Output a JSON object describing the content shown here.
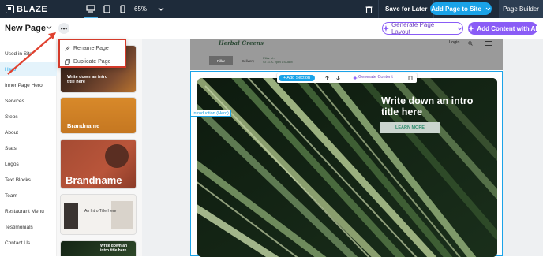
{
  "topbar": {
    "logo": "BLAZE",
    "zoom": "65%",
    "save_later": "Save for Later",
    "add_page": "Add Page to Site",
    "page_builder": "Page Builder"
  },
  "subbar": {
    "page_title": "New Page",
    "generate_layout": "Generate Page Layout",
    "add_content_ai": "Add Content with AI"
  },
  "popup": {
    "rename": "Rename Page",
    "duplicate": "Duplicate Page"
  },
  "sidebar": {
    "items": [
      {
        "label": "Used in Site"
      },
      {
        "label": "Hero"
      },
      {
        "label": "Inner Page Hero"
      },
      {
        "label": "Services"
      },
      {
        "label": "Steps"
      },
      {
        "label": "About"
      },
      {
        "label": "Stats"
      },
      {
        "label": "Logos"
      },
      {
        "label": "Text Blocks"
      },
      {
        "label": "Team"
      },
      {
        "label": "Restaurant Menu"
      },
      {
        "label": "Testimonials"
      },
      {
        "label": "Contact Us"
      }
    ]
  },
  "thumbs": {
    "t1_title": "Write down an intro title here",
    "t2_title": "Brandname",
    "t3_title": "Brandname",
    "t4_title": "An Intro Title Here",
    "t5_title": "Write down an intro title here"
  },
  "canvas": {
    "site_logo": "Herbal Greens",
    "nav_login": "Login",
    "tab1": "Pillar",
    "tab2": "Delivery",
    "nav_info": "Pillar ph\nST.G.A. 2pm 1:00AM",
    "intro_label": "Introduction (Hero)",
    "add_section": "+ Add Section",
    "generate_content": "Generate Content",
    "hero_title": "Write down an intro title here",
    "learn_more": "LEARN MORE"
  },
  "colors": {
    "topbar": "#1e2b3a",
    "accent": "#1aa3e8",
    "ai_purple": "#8a5cf6",
    "callout": "#d43a2a"
  }
}
